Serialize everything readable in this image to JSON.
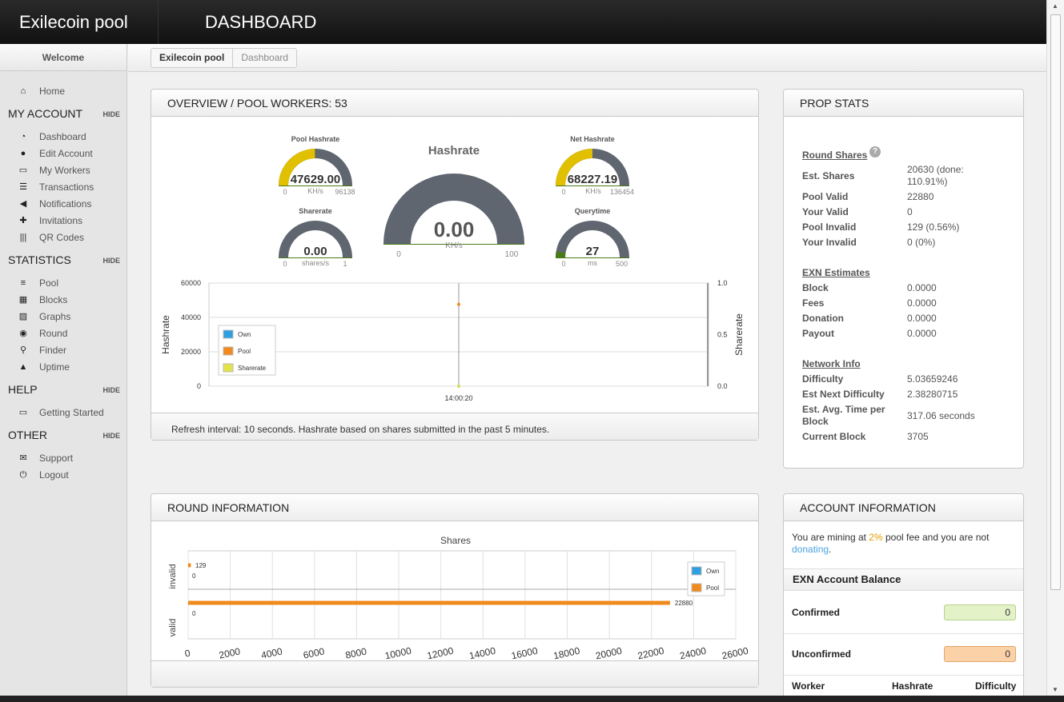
{
  "header": {
    "brand": "Exilecoin pool",
    "title": "DASHBOARD"
  },
  "sidebar": {
    "welcome": "Welcome",
    "home": "Home",
    "hide_label": "HIDE",
    "sections": [
      {
        "title": "MY ACCOUNT",
        "items": [
          "Dashboard",
          "Edit Account",
          "My Workers",
          "Transactions",
          "Notifications",
          "Invitations",
          "QR Codes"
        ]
      },
      {
        "title": "STATISTICS",
        "items": [
          "Pool",
          "Blocks",
          "Graphs",
          "Round",
          "Finder",
          "Uptime"
        ]
      },
      {
        "title": "HELP",
        "items": [
          "Getting Started"
        ]
      },
      {
        "title": "OTHER",
        "items": [
          "Support",
          "Logout"
        ]
      }
    ]
  },
  "breadcrumb": [
    "Exilecoin pool",
    "Dashboard"
  ],
  "overview": {
    "title": "OVERVIEW / POOL WORKERS: 53",
    "gauges": {
      "pool_hashrate": {
        "title": "Pool Hashrate",
        "value": "47629.00",
        "unit": "KH/s",
        "min": "0",
        "max": "96138",
        "fraction": 0.495
      },
      "sharerate": {
        "title": "Sharerate",
        "value": "0.00",
        "unit": "shares/s",
        "min": "0",
        "max": "1",
        "fraction": 0.0
      },
      "hashrate": {
        "title": "Hashrate",
        "value": "0.00",
        "unit": "KH/s",
        "min": "0",
        "max": "100",
        "fraction": 0.0
      },
      "net_hashrate": {
        "title": "Net Hashrate",
        "value": "68227.19",
        "unit": "KH/s",
        "min": "0",
        "max": "136454",
        "fraction": 0.5
      },
      "querytime": {
        "title": "Querytime",
        "value": "27",
        "unit": "ms",
        "min": "0",
        "max": "500",
        "fraction": 0.054
      }
    },
    "footer": "Refresh interval: 10 seconds. Hashrate based on shares submitted in the past 5 minutes."
  },
  "chart_data": [
    {
      "type": "line",
      "x": [
        "14:00:20"
      ],
      "series": [
        {
          "name": "Own",
          "values": [
            0
          ]
        },
        {
          "name": "Pool",
          "values": [
            47629
          ]
        },
        {
          "name": "Sharerate",
          "values": [
            0
          ]
        }
      ],
      "ylabel": "Hashrate",
      "y2label": "Sharerate",
      "ylim": [
        0,
        60000
      ],
      "y2lim": [
        0,
        1.0
      ],
      "yticks": [
        "0",
        "20000",
        "40000",
        "60000"
      ],
      "y2ticks": [
        "0.0",
        "0.5",
        "1.0"
      ],
      "legend": "bottom-left"
    },
    {
      "type": "bar",
      "title": "Shares",
      "orientation": "horizontal",
      "categories": [
        "invalid",
        "valid"
      ],
      "series": [
        {
          "name": "Own",
          "values": [
            0,
            0
          ]
        },
        {
          "name": "Pool",
          "values": [
            129,
            22880
          ]
        }
      ],
      "xlim": [
        0,
        26000
      ],
      "xticks": [
        "0",
        "2000",
        "4000",
        "6000",
        "8000",
        "10000",
        "12000",
        "14000",
        "16000",
        "18000",
        "20000",
        "22000",
        "24000",
        "26000"
      ],
      "legend": "top-right"
    }
  ],
  "prop_stats": {
    "title": "PROP STATS",
    "round_shares": {
      "heading": "Round Shares",
      "rows": [
        {
          "label": "Est. Shares",
          "value": "20630 (done: 110.91%)"
        },
        {
          "label": "Pool Valid",
          "value": "22880"
        },
        {
          "label": "Your Valid",
          "value": "0"
        },
        {
          "label": "Pool Invalid",
          "value": "129 (0.56%)"
        },
        {
          "label": "Your Invalid",
          "value": "0 (0%)"
        }
      ]
    },
    "estimates": {
      "heading": "EXN Estimates",
      "rows": [
        {
          "label": "Block",
          "value": "0.0000"
        },
        {
          "label": "Fees",
          "value": "0.0000"
        },
        {
          "label": "Donation",
          "value": "0.0000"
        },
        {
          "label": "Payout",
          "value": "0.0000"
        }
      ]
    },
    "network": {
      "heading": "Network Info",
      "rows": [
        {
          "label": "Difficulty",
          "value": "5.03659246"
        },
        {
          "label": "Est Next Difficulty",
          "value": "2.38280715"
        },
        {
          "label": "Est. Avg. Time per Block",
          "value": "317.06 seconds"
        },
        {
          "label": "Current Block",
          "value": "3705"
        }
      ]
    }
  },
  "round_info": {
    "title": "ROUND INFORMATION"
  },
  "account": {
    "title": "ACCOUNT INFORMATION",
    "fee_pre": "You are mining at ",
    "fee": "2%",
    "fee_post": " pool fee and you are not",
    "donating": "donating",
    "period": ".",
    "balance_title": "EXN Account Balance",
    "confirmed_label": "Confirmed",
    "confirmed": "0",
    "unconfirmed_label": "Unconfirmed",
    "unconfirmed": "0",
    "workers_headers": [
      "Worker",
      "Hashrate",
      "Difficulty"
    ]
  },
  "colors": {
    "own": "#2f9fe0",
    "pool": "#f08a1c",
    "sharerate": "#e3e24a",
    "gauge_fill": "#e0c000",
    "gauge_bg": "#5f6670"
  }
}
